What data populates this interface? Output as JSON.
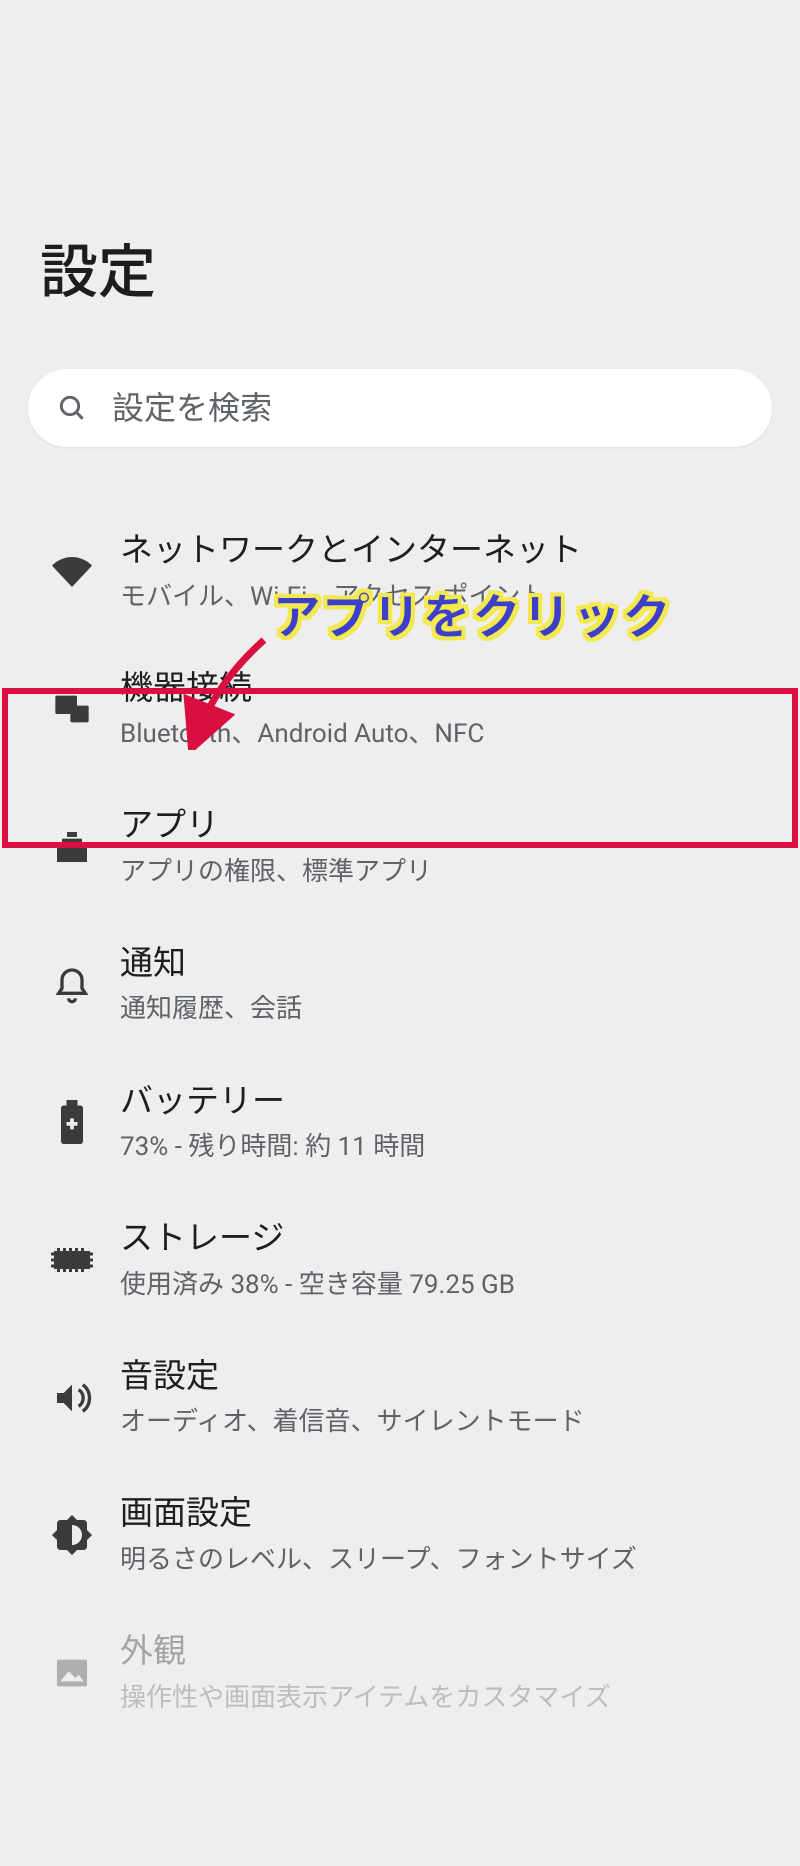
{
  "header": {
    "title": "設定"
  },
  "search": {
    "placeholder": "設定を検索"
  },
  "items": [
    {
      "id": "network",
      "title": "ネットワークとインターネット",
      "subtitle": "モバイル、Wi-Fi、アクセス ポイント"
    },
    {
      "id": "devices",
      "title": "機器接続",
      "subtitle": "Bluetooth、Android Auto、NFC"
    },
    {
      "id": "apps",
      "title": "アプリ",
      "subtitle": "アプリの権限、標準アプリ"
    },
    {
      "id": "notifications",
      "title": "通知",
      "subtitle": "通知履歴、会話"
    },
    {
      "id": "battery",
      "title": "バッテリー",
      "subtitle": "73% - 残り時間: 約 11 時間"
    },
    {
      "id": "storage",
      "title": "ストレージ",
      "subtitle": "使用済み 38% - 空き容量 79.25 GB"
    },
    {
      "id": "sound",
      "title": "音設定",
      "subtitle": "オーディオ、着信音、サイレントモード"
    },
    {
      "id": "display",
      "title": "画面設定",
      "subtitle": "明るさのレベル、スリープ、フォントサイズ"
    },
    {
      "id": "appearance",
      "title": "外観",
      "subtitle": "操作性や画面表示アイテムをカスタマイズ"
    }
  ],
  "annotation": {
    "text": "アプリをクリック"
  }
}
